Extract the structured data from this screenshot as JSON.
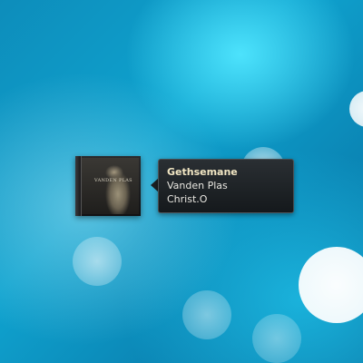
{
  "desktop": {
    "background": "blue bokeh wallpaper"
  },
  "now_playing": {
    "album_cover_icon": "album-cover",
    "cover_logo_text": "VANDEN PLAS",
    "track_title": "Gethsemane",
    "artist": "Vanden Plas",
    "album": "Christ.O"
  },
  "colors": {
    "tooltip_background": "#1b1f22",
    "title_color": "#f2e7c4",
    "text_color": "#e8e6e0"
  }
}
